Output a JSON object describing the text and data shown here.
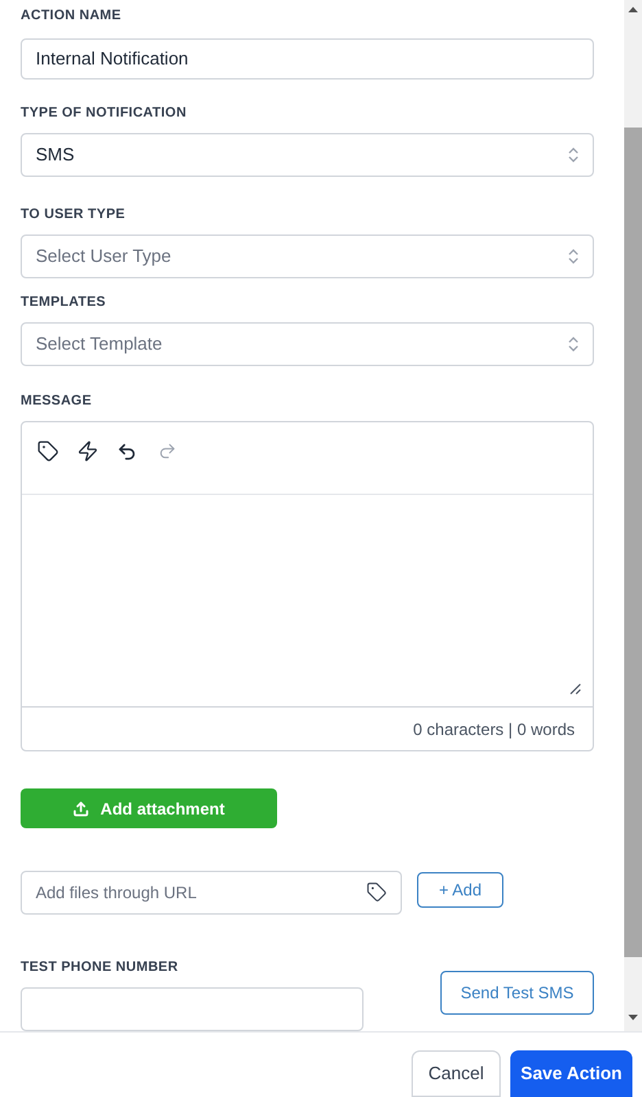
{
  "action_name": {
    "label": "ACTION NAME",
    "value": "Internal Notification"
  },
  "selects": [
    {
      "label": "TYPE OF NOTIFICATION",
      "value": "SMS"
    },
    {
      "label": "TO USER TYPE",
      "placeholder": "Select User Type"
    },
    {
      "label": "TEMPLATES",
      "placeholder": "Select Template"
    }
  ],
  "message": {
    "label": "MESSAGE",
    "toolbar": [
      {
        "kind": "tag",
        "disabled": false
      },
      {
        "kind": "bolt",
        "disabled": false
      },
      {
        "kind": "undo",
        "disabled": false
      },
      {
        "kind": "redo",
        "disabled": true
      }
    ],
    "counter": "0 characters | 0 words"
  },
  "attachment_button": "Add attachment",
  "url_field": {
    "placeholder": "Add files through URL",
    "button": "+ Add"
  },
  "test_phone": {
    "label": "TEST PHONE NUMBER",
    "button": "Send Test SMS"
  },
  "footer": {
    "buttons": [
      {
        "label": "Cancel",
        "kind": "secondary"
      },
      {
        "label": "Save Action",
        "kind": "primary"
      }
    ]
  }
}
